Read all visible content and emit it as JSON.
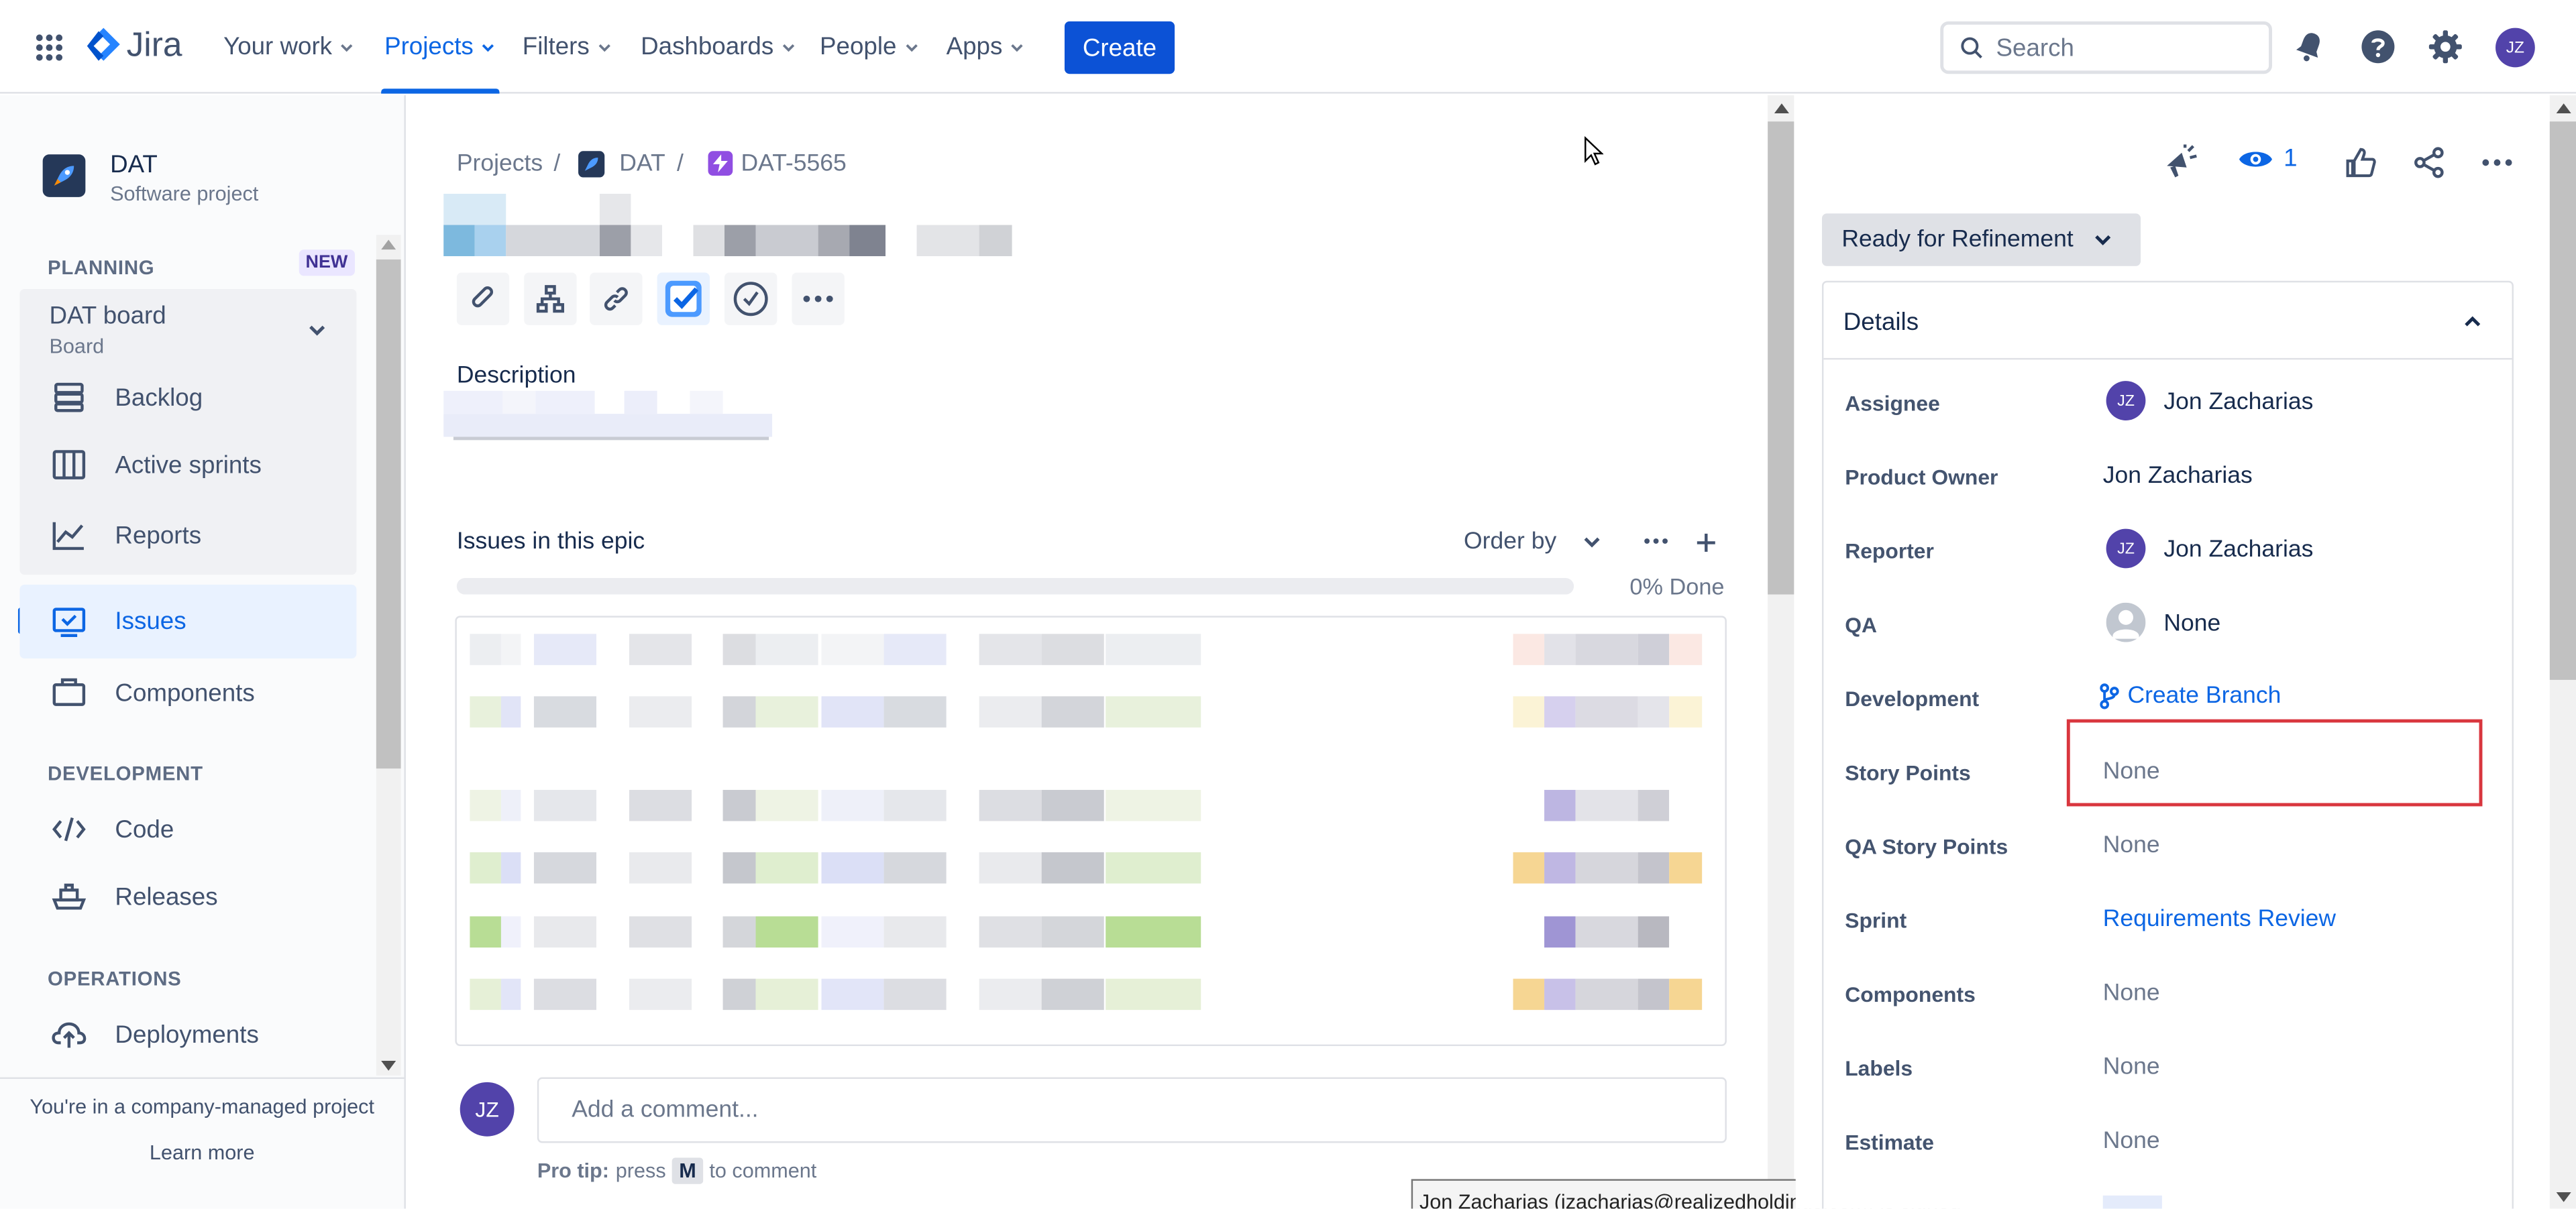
{
  "nav": {
    "brand": "Jira",
    "items": [
      "Your work",
      "Projects",
      "Filters",
      "Dashboards",
      "People",
      "Apps"
    ],
    "active": "Projects",
    "create_label": "Create",
    "search_placeholder": "Search",
    "user_initials": "JZ"
  },
  "sidebar": {
    "project_name": "DAT",
    "project_type": "Software project",
    "planning_label": "PLANNING",
    "new_badge": "NEW",
    "board_name": "DAT board",
    "board_sub": "Board",
    "planning_items": [
      "Backlog",
      "Active sprints",
      "Reports"
    ],
    "issues_label": "Issues",
    "components_label": "Components",
    "development_label": "DEVELOPMENT",
    "development_items": [
      "Code",
      "Releases"
    ],
    "operations_label": "OPERATIONS",
    "operations_items": [
      "Deployments"
    ],
    "footer_text": "You're in a company-managed project",
    "learn_more": "Learn more"
  },
  "main": {
    "breadcrumb": [
      "Projects",
      "DAT",
      "DAT-5565"
    ],
    "description_label": "Description",
    "issues_header": "Issues in this epic",
    "order_by": "Order by",
    "progress_text": "0% Done",
    "progress": 0,
    "comment_placeholder": "Add a comment...",
    "pro_tip_label": "Pro tip:",
    "pro_tip_press": "press",
    "pro_tip_key": "M",
    "pro_tip_suffix": "to comment",
    "user_initials": "JZ",
    "tooltip": "Jon Zacharias (jzacharias@realizedholdings.com) is signed in"
  },
  "details": {
    "watch_count": "1",
    "status": "Ready for Refinement",
    "header": "Details",
    "assignee_label": "Assignee",
    "assignee": "Jon Zacharias",
    "assignee_initials": "JZ",
    "product_owner_label": "Product Owner",
    "product_owner": "Jon Zacharias",
    "reporter_label": "Reporter",
    "reporter": "Jon Zacharias",
    "reporter_initials": "JZ",
    "qa_label": "QA",
    "qa": "None",
    "development_label": "Development",
    "development": "Create Branch",
    "story_points_label": "Story Points",
    "story_points": "None",
    "qa_story_points_label": "QA Story Points",
    "qa_story_points": "None",
    "sprint_label": "Sprint",
    "sprint": "Requirements Review",
    "components_label": "Components",
    "components": "None",
    "labels_label": "Labels",
    "labels": "None",
    "estimate_label": "Estimate",
    "estimate": "None"
  },
  "colors": {
    "accent": "#0c66e4",
    "create_button": "#0c52d6",
    "avatar": "#5243aa",
    "highlight_box": "#d9363e"
  }
}
